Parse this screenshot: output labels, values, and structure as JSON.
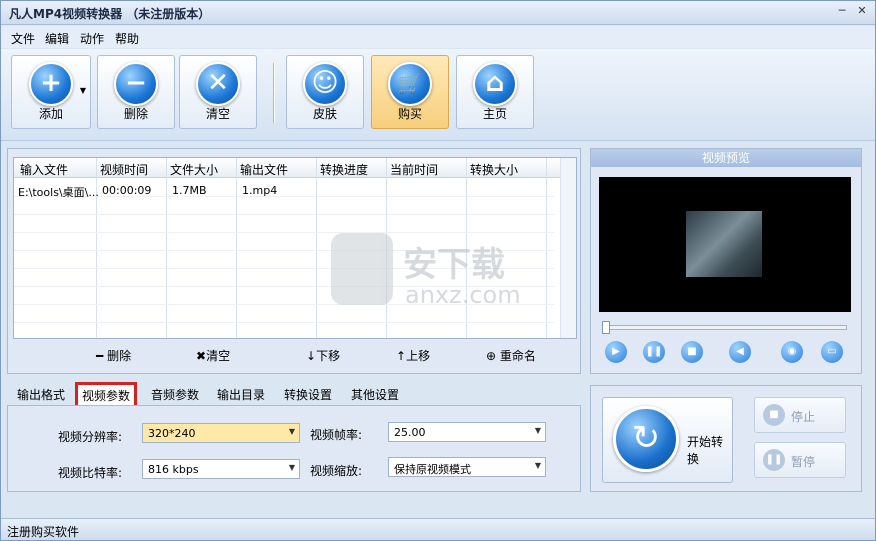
{
  "window": {
    "title": "凡人MP4视频转换器 （未注册版本）",
    "min": "─",
    "close": "✕"
  },
  "menu": [
    "文件",
    "编辑",
    "动作",
    "帮助"
  ],
  "toolbar": {
    "add": "添加",
    "delete": "删除",
    "clear": "清空",
    "skin": "皮肤",
    "buy": "购买",
    "home": "主页",
    "add_icon": "plus-icon",
    "delete_icon": "minus-icon",
    "clear_icon": "x-icon",
    "skin_icon": "smiley-icon",
    "buy_icon": "cart-icon",
    "home_icon": "home-icon"
  },
  "file_list": {
    "columns": [
      "输入文件",
      "视频时间",
      "文件大小",
      "输出文件",
      "转换进度",
      "当前时间",
      "转换大小"
    ],
    "rows": [
      [
        "E:\\tools\\桌面\\...",
        "00:00:09",
        "1.7MB",
        "1.mp4",
        "",
        "",
        ""
      ]
    ],
    "actions": {
      "remove": "删除",
      "clear": "清空",
      "down": "下移",
      "up": "上移",
      "rename": "重命名"
    }
  },
  "preview": {
    "title": "视频预览",
    "controls": [
      "play-icon",
      "pause-icon",
      "stop-icon",
      "volume-icon",
      "snapshot-icon",
      "folder-icon"
    ]
  },
  "tabs": [
    "输出格式",
    "视频参数",
    "音频参数",
    "输出目录",
    "转换设置",
    "其他设置"
  ],
  "selected_tab": "视频参数",
  "params": {
    "resolution_label": "视频分辨率:",
    "resolution_value": "320*240",
    "framerate_label": "视频帧率:",
    "framerate_value": "25.00",
    "bitrate_label": "视频比特率:",
    "bitrate_value": "816 kbps",
    "scale_label": "视频缩放:",
    "scale_value": "保持原视频模式"
  },
  "convert": {
    "start": "开始转换",
    "stop": "停止",
    "pause": "暂停"
  },
  "watermark": {
    "text": "安下载",
    "url": "anxz.com"
  },
  "status": "注册购买软件"
}
